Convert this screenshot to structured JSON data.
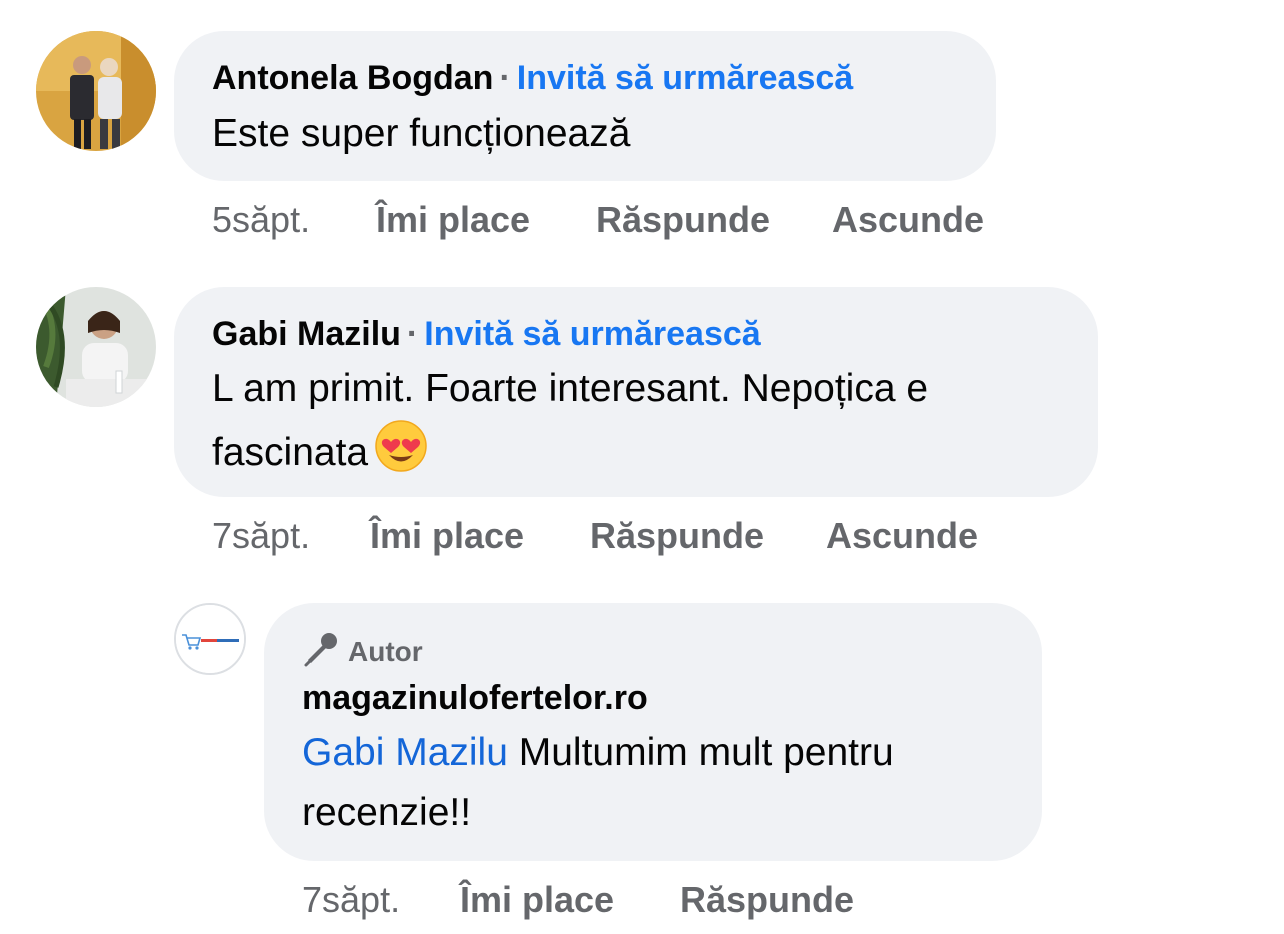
{
  "comments": [
    {
      "author": "Antonela Bogdan",
      "separator": "·",
      "invite_label": "Invită să urmărească",
      "text": "Este super funcționează",
      "time": "5săpt.",
      "actions": [
        "Îmi place",
        "Răspunde",
        "Ascunde"
      ]
    },
    {
      "author": "Gabi Mazilu",
      "separator": "·",
      "invite_label": "Invită să urmărească",
      "text_line1": "L am primit. Foarte interesant. Nepoțica e",
      "text_line2": "fascinata",
      "emoji": "smiling-face-with-heart-eyes",
      "time": "7săpt.",
      "actions": [
        "Îmi place",
        "Răspunde",
        "Ascunde"
      ]
    }
  ],
  "reply": {
    "badge_icon": "microphone-icon",
    "badge_label": "Autor",
    "author": "magazinulofertelor.ro",
    "mention": "Gabi Mazilu",
    "text_line1": " Multumim mult pentru",
    "text_line2": "recenzie!!",
    "time": "7săpt.",
    "actions": [
      "Îmi place",
      "Răspunde"
    ]
  },
  "colors": {
    "link_blue": "#1877f2",
    "mention_blue": "#1466d8",
    "bubble_bg": "#f0f2f5",
    "meta_gray": "#65676b"
  }
}
